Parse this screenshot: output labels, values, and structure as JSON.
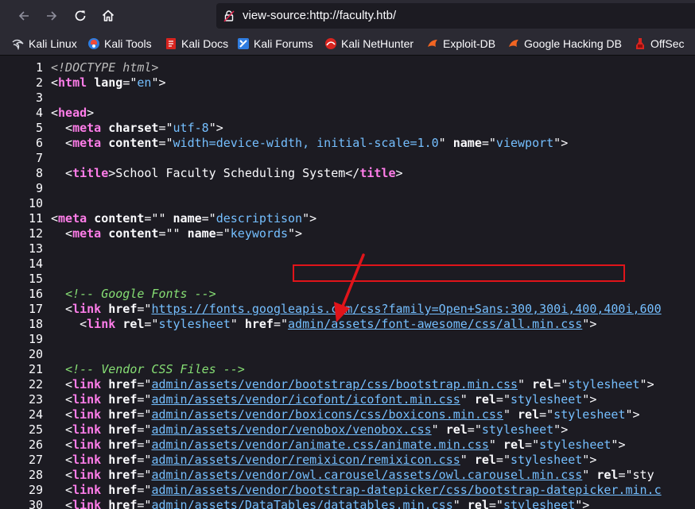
{
  "browser": {
    "url": "view-source:http://faculty.htb/",
    "bookmarks": [
      {
        "label": "Kali Linux",
        "icon": "kali-dragon-icon"
      },
      {
        "label": "Kali Tools",
        "icon": "kali-tools-icon"
      },
      {
        "label": "Kali Docs",
        "icon": "kali-docs-icon"
      },
      {
        "label": "Kali Forums",
        "icon": "kali-forums-icon"
      },
      {
        "label": "Kali NetHunter",
        "icon": "kali-nethunter-icon"
      },
      {
        "label": "Exploit-DB",
        "icon": "exploit-db-icon"
      },
      {
        "label": "Google Hacking DB",
        "icon": "google-hacking-db-icon"
      },
      {
        "label": "OffSec",
        "icon": "offsec-icon"
      }
    ]
  },
  "source": {
    "lines": [
      {
        "n": "1",
        "parts": [
          [
            "d",
            "<!DOCTYPE html>"
          ]
        ]
      },
      {
        "n": "2",
        "parts": [
          [
            "p",
            "<"
          ],
          [
            "t",
            "html"
          ],
          [
            "p",
            " "
          ],
          [
            "a",
            "lang"
          ],
          [
            "p",
            "=\""
          ],
          [
            "v",
            "en"
          ],
          [
            "p",
            "\">"
          ]
        ]
      },
      {
        "n": "3",
        "parts": []
      },
      {
        "n": "4",
        "parts": [
          [
            "p",
            "<"
          ],
          [
            "t",
            "head"
          ],
          [
            "p",
            ">"
          ]
        ]
      },
      {
        "n": "5",
        "parts": [
          [
            "p",
            "  <"
          ],
          [
            "t",
            "meta"
          ],
          [
            "p",
            " "
          ],
          [
            "a",
            "charset"
          ],
          [
            "p",
            "=\""
          ],
          [
            "v",
            "utf-8"
          ],
          [
            "p",
            "\">"
          ]
        ]
      },
      {
        "n": "6",
        "parts": [
          [
            "p",
            "  <"
          ],
          [
            "t",
            "meta"
          ],
          [
            "p",
            " "
          ],
          [
            "a",
            "content"
          ],
          [
            "p",
            "=\""
          ],
          [
            "v",
            "width=device-width, initial-scale=1.0"
          ],
          [
            "p",
            "\" "
          ],
          [
            "a",
            "name"
          ],
          [
            "p",
            "=\""
          ],
          [
            "v",
            "viewport"
          ],
          [
            "p",
            "\">"
          ]
        ]
      },
      {
        "n": "7",
        "parts": []
      },
      {
        "n": "8",
        "parts": [
          [
            "p",
            "  <"
          ],
          [
            "t",
            "title"
          ],
          [
            "p",
            ">School Faculty Scheduling System</"
          ],
          [
            "t",
            "title"
          ],
          [
            "p",
            ">"
          ]
        ]
      },
      {
        "n": "9",
        "parts": []
      },
      {
        "n": "10",
        "parts": []
      },
      {
        "n": "11",
        "parts": [
          [
            "p",
            "<"
          ],
          [
            "t",
            "meta"
          ],
          [
            "p",
            " "
          ],
          [
            "a",
            "content"
          ],
          [
            "p",
            "=\"\" "
          ],
          [
            "a",
            "name"
          ],
          [
            "p",
            "=\""
          ],
          [
            "v",
            "descriptison"
          ],
          [
            "p",
            "\">"
          ]
        ]
      },
      {
        "n": "12",
        "parts": [
          [
            "p",
            "  <"
          ],
          [
            "t",
            "meta"
          ],
          [
            "p",
            " "
          ],
          [
            "a",
            "content"
          ],
          [
            "p",
            "=\"\" "
          ],
          [
            "a",
            "name"
          ],
          [
            "p",
            "=\""
          ],
          [
            "v",
            "keywords"
          ],
          [
            "p",
            "\">"
          ]
        ]
      },
      {
        "n": "13",
        "parts": []
      },
      {
        "n": "14",
        "parts": []
      },
      {
        "n": "15",
        "parts": []
      },
      {
        "n": "16",
        "parts": [
          [
            "p",
            "  "
          ],
          [
            "c",
            "<!-- Google Fonts -->"
          ]
        ]
      },
      {
        "n": "17",
        "parts": [
          [
            "p",
            "  <"
          ],
          [
            "t",
            "link"
          ],
          [
            "p",
            " "
          ],
          [
            "a",
            "href"
          ],
          [
            "p",
            "=\""
          ],
          [
            "l",
            "https://fonts.googleapis.com/css?family=Open+Sans:300,300i,400,400i,600"
          ]
        ]
      },
      {
        "n": "18",
        "parts": [
          [
            "p",
            "    <"
          ],
          [
            "t",
            "link"
          ],
          [
            "p",
            " "
          ],
          [
            "a",
            "rel"
          ],
          [
            "p",
            "=\""
          ],
          [
            "v",
            "stylesheet"
          ],
          [
            "p",
            "\" "
          ],
          [
            "a",
            "href"
          ],
          [
            "p",
            "=\""
          ],
          [
            "l",
            "admin/assets/font-awesome/css/all.min.css"
          ],
          [
            "p",
            "\">"
          ]
        ]
      },
      {
        "n": "19",
        "parts": []
      },
      {
        "n": "20",
        "parts": []
      },
      {
        "n": "21",
        "parts": [
          [
            "p",
            "  "
          ],
          [
            "c",
            "<!-- Vendor CSS Files -->"
          ]
        ]
      },
      {
        "n": "22",
        "parts": [
          [
            "p",
            "  <"
          ],
          [
            "t",
            "link"
          ],
          [
            "p",
            " "
          ],
          [
            "a",
            "href"
          ],
          [
            "p",
            "=\""
          ],
          [
            "l",
            "admin/assets/vendor/bootstrap/css/bootstrap.min.css"
          ],
          [
            "p",
            "\" "
          ],
          [
            "a",
            "rel"
          ],
          [
            "p",
            "=\""
          ],
          [
            "v",
            "stylesheet"
          ],
          [
            "p",
            "\">"
          ]
        ]
      },
      {
        "n": "23",
        "parts": [
          [
            "p",
            "  <"
          ],
          [
            "t",
            "link"
          ],
          [
            "p",
            " "
          ],
          [
            "a",
            "href"
          ],
          [
            "p",
            "=\""
          ],
          [
            "l",
            "admin/assets/vendor/icofont/icofont.min.css"
          ],
          [
            "p",
            "\" "
          ],
          [
            "a",
            "rel"
          ],
          [
            "p",
            "=\""
          ],
          [
            "v",
            "stylesheet"
          ],
          [
            "p",
            "\">"
          ]
        ]
      },
      {
        "n": "24",
        "parts": [
          [
            "p",
            "  <"
          ],
          [
            "t",
            "link"
          ],
          [
            "p",
            " "
          ],
          [
            "a",
            "href"
          ],
          [
            "p",
            "=\""
          ],
          [
            "l",
            "admin/assets/vendor/boxicons/css/boxicons.min.css"
          ],
          [
            "p",
            "\" "
          ],
          [
            "a",
            "rel"
          ],
          [
            "p",
            "=\""
          ],
          [
            "v",
            "stylesheet"
          ],
          [
            "p",
            "\">"
          ]
        ]
      },
      {
        "n": "25",
        "parts": [
          [
            "p",
            "  <"
          ],
          [
            "t",
            "link"
          ],
          [
            "p",
            " "
          ],
          [
            "a",
            "href"
          ],
          [
            "p",
            "=\""
          ],
          [
            "l",
            "admin/assets/vendor/venobox/venobox.css"
          ],
          [
            "p",
            "\" "
          ],
          [
            "a",
            "rel"
          ],
          [
            "p",
            "=\""
          ],
          [
            "v",
            "stylesheet"
          ],
          [
            "p",
            "\">"
          ]
        ]
      },
      {
        "n": "26",
        "parts": [
          [
            "p",
            "  <"
          ],
          [
            "t",
            "link"
          ],
          [
            "p",
            " "
          ],
          [
            "a",
            "href"
          ],
          [
            "p",
            "=\""
          ],
          [
            "l",
            "admin/assets/vendor/animate.css/animate.min.css"
          ],
          [
            "p",
            "\" "
          ],
          [
            "a",
            "rel"
          ],
          [
            "p",
            "=\""
          ],
          [
            "v",
            "stylesheet"
          ],
          [
            "p",
            "\">"
          ]
        ]
      },
      {
        "n": "27",
        "parts": [
          [
            "p",
            "  <"
          ],
          [
            "t",
            "link"
          ],
          [
            "p",
            " "
          ],
          [
            "a",
            "href"
          ],
          [
            "p",
            "=\""
          ],
          [
            "l",
            "admin/assets/vendor/remixicon/remixicon.css"
          ],
          [
            "p",
            "\" "
          ],
          [
            "a",
            "rel"
          ],
          [
            "p",
            "=\""
          ],
          [
            "v",
            "stylesheet"
          ],
          [
            "p",
            "\">"
          ]
        ]
      },
      {
        "n": "28",
        "parts": [
          [
            "p",
            "  <"
          ],
          [
            "t",
            "link"
          ],
          [
            "p",
            " "
          ],
          [
            "a",
            "href"
          ],
          [
            "p",
            "=\""
          ],
          [
            "l",
            "admin/assets/vendor/owl.carousel/assets/owl.carousel.min.css"
          ],
          [
            "p",
            "\" "
          ],
          [
            "a",
            "rel"
          ],
          [
            "p",
            "=\"sty"
          ]
        ]
      },
      {
        "n": "29",
        "parts": [
          [
            "p",
            "  <"
          ],
          [
            "t",
            "link"
          ],
          [
            "p",
            " "
          ],
          [
            "a",
            "href"
          ],
          [
            "p",
            "=\""
          ],
          [
            "l",
            "admin/assets/vendor/bootstrap-datepicker/css/bootstrap-datepicker.min.c"
          ]
        ]
      },
      {
        "n": "30",
        "parts": [
          [
            "p",
            "  <"
          ],
          [
            "t",
            "link"
          ],
          [
            "p",
            " "
          ],
          [
            "a",
            "href"
          ],
          [
            "p",
            "=\""
          ],
          [
            "l",
            "admin/assets/DataTables/datatables.min.css"
          ],
          [
            "p",
            "\" "
          ],
          [
            "a",
            "rel"
          ],
          [
            "p",
            "=\""
          ],
          [
            "v",
            "stylesheet"
          ],
          [
            "p",
            "\">"
          ]
        ]
      }
    ]
  },
  "colors": {
    "tag": "#ff7de9",
    "attr_value": "#75bfff",
    "comment": "#86de74",
    "annotation": "#e0141a"
  }
}
